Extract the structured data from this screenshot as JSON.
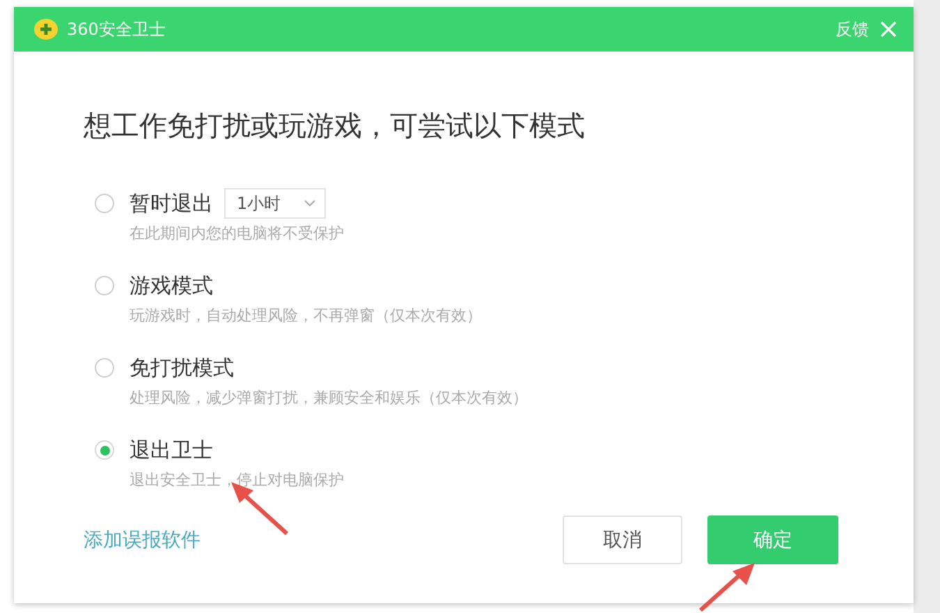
{
  "window": {
    "title": "360安全卫士",
    "feedback": "反馈"
  },
  "heading": "想工作免打扰或玩游戏，可尝试以下模式",
  "options": [
    {
      "label": "暂时退出",
      "description": "在此期间内您的电脑将不受保护",
      "selected": false,
      "dropdown": "1小时"
    },
    {
      "label": "游戏模式",
      "description": "玩游戏时，自动处理风险，不再弹窗（仅本次有效）",
      "selected": false
    },
    {
      "label": "免打扰模式",
      "description": "处理风险，减少弹窗打扰，兼顾安全和娱乐（仅本次有效）",
      "selected": false
    },
    {
      "label": "退出卫士",
      "description": "退出安全卫士，停止对电脑保护",
      "selected": true
    }
  ],
  "link": "添加误报软件",
  "buttons": [
    {
      "label": "取消",
      "kind": "secondary"
    },
    {
      "label": "确定",
      "kind": "primary"
    }
  ]
}
